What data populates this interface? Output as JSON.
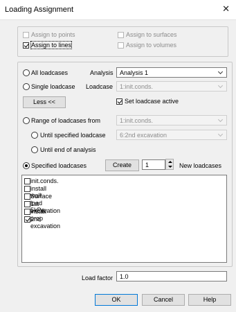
{
  "window": {
    "title": "Loading Assignment",
    "close_glyph": "✕"
  },
  "assign": {
    "points": "Assign to points",
    "lines": "Assign to lines",
    "surfaces": "Assign to surfaces",
    "volumes": "Assign to volumes"
  },
  "loadcases": {
    "all": "All loadcases",
    "analysis_label": "Analysis",
    "analysis_value": "Analysis 1",
    "single": "Single loadcase",
    "loadcase_label": "Loadcase",
    "loadcase_value": "1:init.conds.",
    "less_button": "Less <<",
    "set_active": "Set loadcase active",
    "range_from": "Range of loadcases from",
    "range_from_value": "1:init.conds.",
    "until_specified": "Until specified loadcase",
    "until_specified_value": "6:2nd excavation",
    "until_end": "Until end of analysis",
    "specified": "Specified loadcases",
    "create_button": "Create",
    "create_count": "1",
    "new_loadcases": "New loadcases"
  },
  "list_items": [
    {
      "label": "init.conds.",
      "checked": false
    },
    {
      "label": "install wall",
      "checked": false
    },
    {
      "label": "Surface load 5kPa",
      "checked": false
    },
    {
      "label": "1st excavation",
      "checked": false
    },
    {
      "label": "install prop",
      "checked": false
    },
    {
      "label": "2nd excavation",
      "checked": true
    }
  ],
  "load_factor": {
    "label": "Load factor",
    "value": "1.0"
  },
  "buttons": {
    "ok": "OK",
    "cancel": "Cancel",
    "help": "Help"
  }
}
